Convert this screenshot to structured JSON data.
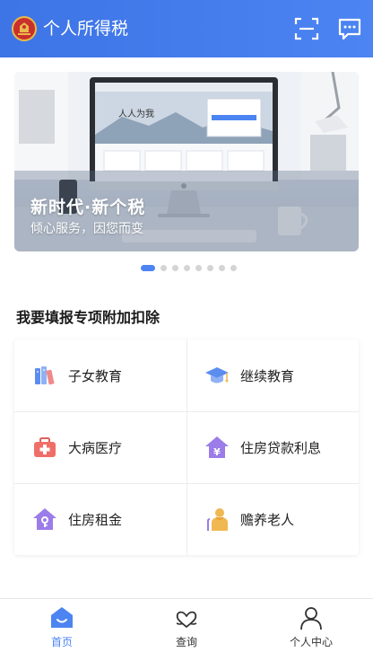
{
  "header": {
    "title": "个人所得税",
    "scan_icon": "scan-icon",
    "message_icon": "message-icon",
    "background": "#4c84f2"
  },
  "banner": {
    "title": "新时代·新个税",
    "subtitle": "倾心服务，因您而变",
    "page_count": 8,
    "active_page": 1
  },
  "deductions": {
    "title": "我要填报专项附加扣除",
    "items": [
      {
        "label": "子女教育",
        "icon": "books-icon"
      },
      {
        "label": "继续教育",
        "icon": "graduation-cap-icon"
      },
      {
        "label": "大病医疗",
        "icon": "medical-kit-icon"
      },
      {
        "label": "住房贷款利息",
        "icon": "house-loan-icon"
      },
      {
        "label": "住房租金",
        "icon": "house-key-icon"
      },
      {
        "label": "赡养老人",
        "icon": "elderly-person-icon"
      }
    ]
  },
  "bottom_nav": {
    "items": [
      {
        "label": "首页",
        "icon": "home-icon",
        "active": true
      },
      {
        "label": "查询",
        "icon": "query-heart-icon",
        "active": false
      },
      {
        "label": "个人中心",
        "icon": "user-icon",
        "active": false
      }
    ],
    "accent": "#4c84f2"
  }
}
